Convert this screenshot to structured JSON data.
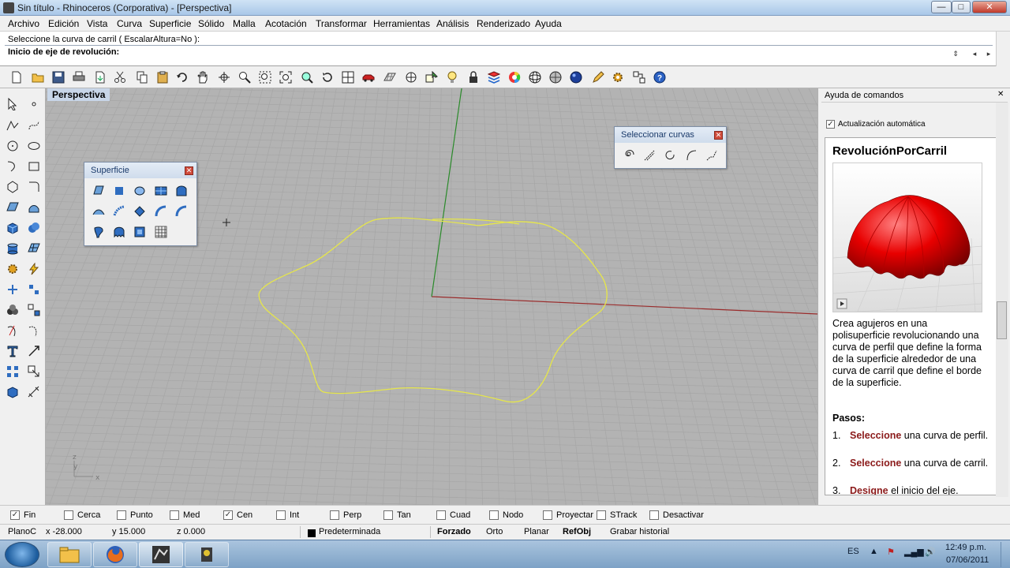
{
  "window": {
    "title": "Sin título - Rhinoceros (Corporativa) - [Perspectiva]",
    "controls": {
      "minimize": "—",
      "maximize": "□",
      "close": "✕"
    }
  },
  "menu": [
    "Archivo",
    "Edición",
    "Vista",
    "Curva",
    "Superficie",
    "Sólido",
    "Malla",
    "Acotación",
    "Transformar",
    "Herramientas",
    "Análisis",
    "Renderizado",
    "Ayuda"
  ],
  "command": {
    "history": "Seleccione la curva de carril ( EscalarAltura=No ):",
    "prompt": "Inicio de eje de revolución:"
  },
  "toolbar_icons": [
    "new-icon",
    "open-icon",
    "save-icon",
    "print-icon",
    "import-icon",
    "cut-icon",
    "copy-icon",
    "paste-icon",
    "undo-icon",
    "pan-icon",
    "rotate-view-icon",
    "zoom-icon",
    "zoom-window-icon",
    "zoom-extents-icon",
    "zoom-selected-icon",
    "rotate-icon",
    "four-viewports-icon",
    "car-icon",
    "grid-icon",
    "osnap-icon",
    "select-filter-icon",
    "light-icon",
    "lock-icon",
    "layer-icon",
    "color-wheel-icon",
    "sphere-wire-icon",
    "sphere-shaded-icon",
    "sphere-render-icon",
    "pencil-icon",
    "settings-icon",
    "options-icon",
    "help-icon"
  ],
  "viewport": {
    "label": "Perspectiva",
    "axis_labels": {
      "z": "z",
      "y": "y",
      "x": "x"
    }
  },
  "panels": {
    "superficie": {
      "title": "Superficie",
      "close": "✕"
    },
    "seleccionar": {
      "title": "Seleccionar curvas",
      "close": "✕"
    }
  },
  "help": {
    "header": "Ayuda de comandos",
    "auto_update_label": "Actualización automática",
    "auto_update_checked": true,
    "title": "RevoluciónPorCarril",
    "description": "Crea agujeros en una polisuperficie revolucionando una curva de perfil que define la forma de la superficie alrededor de una curva de carril que define el borde de la superficie.",
    "steps_heading": "Pasos:",
    "steps": [
      {
        "num": "1.",
        "keyword": "Seleccione",
        "rest": " una curva de perfil."
      },
      {
        "num": "2.",
        "keyword": "Seleccione",
        "rest": " una curva de carril."
      },
      {
        "num": "3.",
        "keyword": "Designe",
        "rest": " el inicio del eje."
      }
    ]
  },
  "osnaps": [
    {
      "label": "Fin",
      "checked": true
    },
    {
      "label": "Cerca",
      "checked": false
    },
    {
      "label": "Punto",
      "checked": false
    },
    {
      "label": "Med",
      "checked": false
    },
    {
      "label": "Cen",
      "checked": true
    },
    {
      "label": "Int",
      "checked": false
    },
    {
      "label": "Perp",
      "checked": false
    },
    {
      "label": "Tan",
      "checked": false
    },
    {
      "label": "Cuad",
      "checked": false
    },
    {
      "label": "Nodo",
      "checked": false
    },
    {
      "label": "Proyectar",
      "checked": false
    },
    {
      "label": "STrack",
      "checked": false
    },
    {
      "label": "Desactivar",
      "checked": false
    }
  ],
  "status": {
    "cplane": "PlanoC",
    "x": "x -28.000",
    "y": "y 15.000",
    "z": "z 0.000",
    "layer": "Predeterminada",
    "forzado": "Forzado",
    "orto": "Orto",
    "planar": "Planar",
    "refobj": "RefObj",
    "grabar": "Grabar historial"
  },
  "taskbar": {
    "lang": "ES",
    "time": "12:49 p.m.",
    "date": "07/06/2011"
  }
}
